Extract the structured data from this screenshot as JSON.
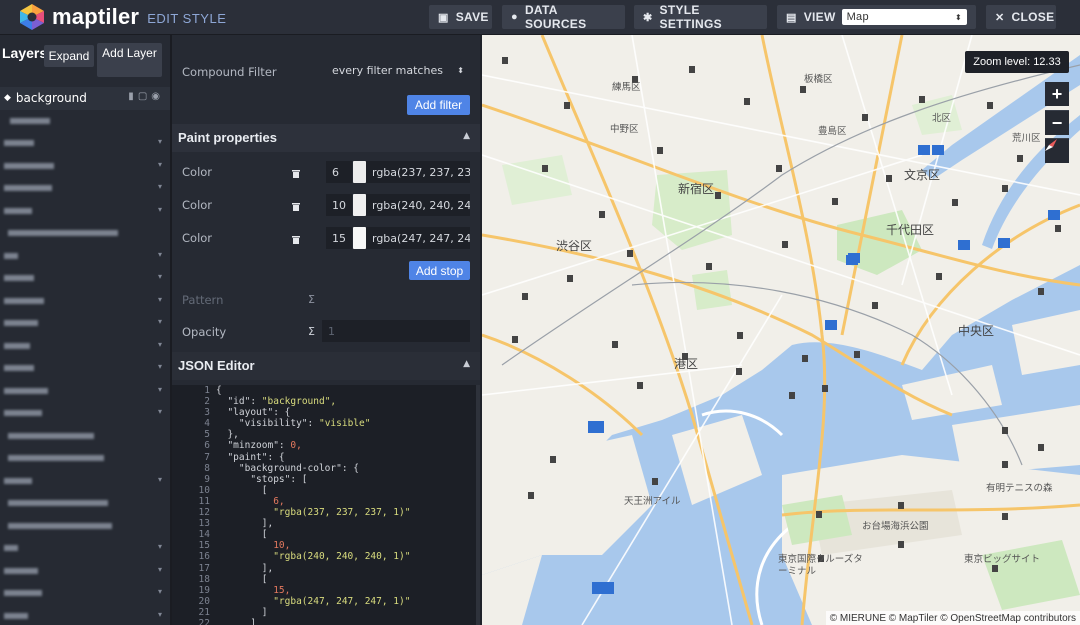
{
  "app": {
    "brand": "maptiler",
    "subtitle": "EDIT STYLE"
  },
  "toolbar": {
    "save": "SAVE",
    "data_sources": "DATA SOURCES",
    "style_settings": "STYLE SETTINGS",
    "view": "VIEW",
    "view_selected": "Map",
    "close": "CLOSE"
  },
  "layers": {
    "title": "Layers",
    "expand": "Expand",
    "add_layer": "Add Layer",
    "active": "background"
  },
  "editor": {
    "compound_filter_label": "Compound Filter",
    "compound_filter_value": "every filter matches",
    "add_filter": "Add filter",
    "paint_title": "Paint properties",
    "color_stops": [
      {
        "label": "Color",
        "zoom": "6",
        "value": "rgba(237, 237, 237, 1)",
        "swatch": "#ededed"
      },
      {
        "label": "Color",
        "zoom": "10",
        "value": "rgba(240, 240, 240, 1)",
        "swatch": "#f0f0f0"
      },
      {
        "label": "Color",
        "zoom": "15",
        "value": "rgba(247, 247, 247, 1)",
        "swatch": "#f7f7f7"
      }
    ],
    "add_stop": "Add stop",
    "pattern_label": "Pattern",
    "opacity_label": "Opacity",
    "opacity_value": "1",
    "json_title": "JSON Editor"
  },
  "json_lines": [
    {
      "n": "1",
      "t": "{"
    },
    {
      "n": "2",
      "t": "  \"id\": \"background\","
    },
    {
      "n": "3",
      "t": "  \"layout\": {"
    },
    {
      "n": "4",
      "t": "    \"visibility\": \"visible\""
    },
    {
      "n": "5",
      "t": "  },"
    },
    {
      "n": "6",
      "t": "  \"minzoom\": 0,"
    },
    {
      "n": "7",
      "t": "  \"paint\": {"
    },
    {
      "n": "8",
      "t": "    \"background-color\": {"
    },
    {
      "n": "9",
      "t": "      \"stops\": ["
    },
    {
      "n": "10",
      "t": "        ["
    },
    {
      "n": "11",
      "t": "          6,"
    },
    {
      "n": "12",
      "t": "          \"rgba(237, 237, 237, 1)\""
    },
    {
      "n": "13",
      "t": "        ],"
    },
    {
      "n": "14",
      "t": "        ["
    },
    {
      "n": "15",
      "t": "          10,"
    },
    {
      "n": "16",
      "t": "          \"rgba(240, 240, 240, 1)\""
    },
    {
      "n": "17",
      "t": "        ],"
    },
    {
      "n": "18",
      "t": "        ["
    },
    {
      "n": "19",
      "t": "          15,"
    },
    {
      "n": "20",
      "t": "          \"rgba(247, 247, 247, 1)\""
    },
    {
      "n": "21",
      "t": "        ]"
    },
    {
      "n": "22",
      "t": "      ]"
    }
  ],
  "map": {
    "zoom_label": "Zoom level: 12.33",
    "zoom_in": "+",
    "zoom_out": "−",
    "attribution": "© MIERUNE  © MapTiler © OpenStreetMap contributors",
    "places": [
      {
        "name": "練馬区",
        "cls": "small"
      },
      {
        "name": "板橋区",
        "cls": "small"
      },
      {
        "name": "北区",
        "cls": "small"
      },
      {
        "name": "中野区",
        "cls": "small"
      },
      {
        "name": "豊島区",
        "cls": "small"
      },
      {
        "name": "荒川区",
        "cls": "small"
      },
      {
        "name": "新宿区",
        "cls": ""
      },
      {
        "name": "文京区",
        "cls": ""
      },
      {
        "name": "渋谷区",
        "cls": ""
      },
      {
        "name": "千代田区",
        "cls": ""
      },
      {
        "name": "中央区",
        "cls": ""
      },
      {
        "name": "港区",
        "cls": ""
      },
      {
        "name": "天王洲アイル",
        "cls": "small"
      },
      {
        "name": "お台場海浜公園",
        "cls": "small"
      },
      {
        "name": "東京国際クルーズターミナル",
        "cls": "small"
      },
      {
        "name": "東京ビッグサイト",
        "cls": "small"
      },
      {
        "name": "有明テニスの森",
        "cls": "small"
      }
    ]
  },
  "colors": {
    "accent": "#4f84e6",
    "panel": "#262a33",
    "topbar": "#2b2f39",
    "water": "#a8c8ec",
    "land": "#f1efe9",
    "park": "#cde8bf"
  }
}
